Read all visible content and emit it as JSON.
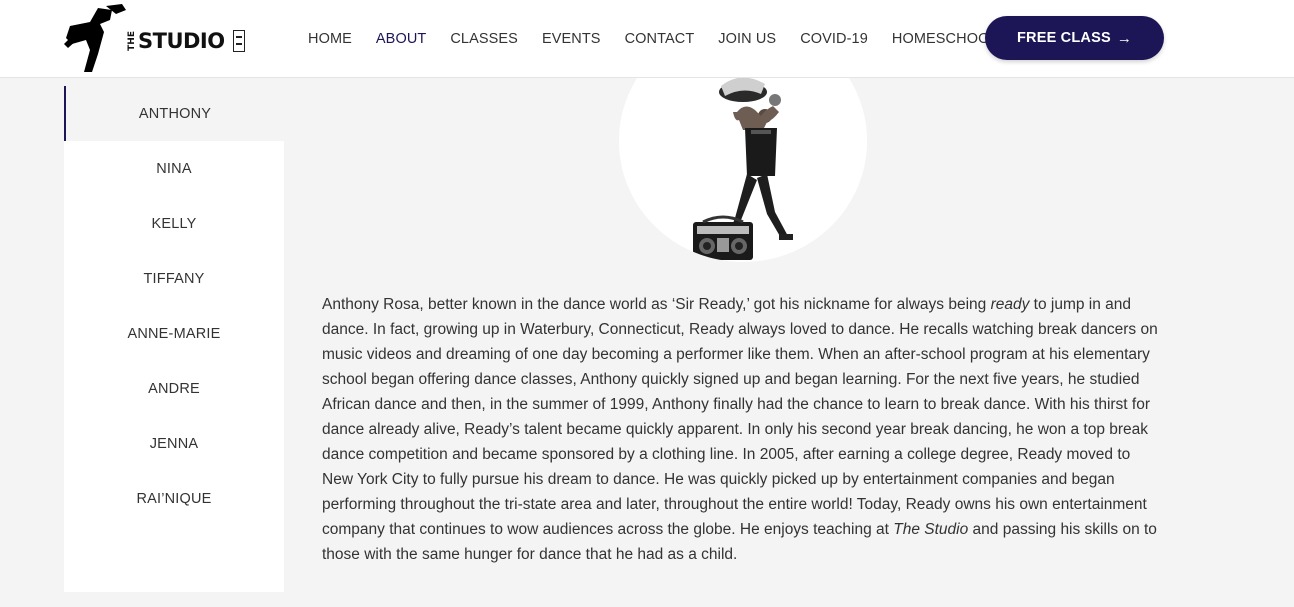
{
  "header": {
    "logo_text": "STUDIO",
    "logo_small": "THE"
  },
  "nav": {
    "items": [
      {
        "label": "HOME",
        "active": false
      },
      {
        "label": "ABOUT",
        "active": true
      },
      {
        "label": "CLASSES",
        "active": false
      },
      {
        "label": "EVENTS",
        "active": false
      },
      {
        "label": "CONTACT",
        "active": false
      },
      {
        "label": "JOIN US",
        "active": false
      },
      {
        "label": "COVID-19",
        "active": false
      },
      {
        "label": "HOMESCHOOL",
        "active": false
      }
    ],
    "cta_label": "FREE CLASS",
    "cta_icon": "arrow-right-icon"
  },
  "sidebar": {
    "items": [
      {
        "label": "ANTHONY",
        "active": true
      },
      {
        "label": "NINA",
        "active": false
      },
      {
        "label": "KELLY",
        "active": false
      },
      {
        "label": "TIFFANY",
        "active": false
      },
      {
        "label": "ANNE-MARIE",
        "active": false
      },
      {
        "label": "ANDRE",
        "active": false
      },
      {
        "label": "JENNA",
        "active": false
      },
      {
        "label": "RAI’NIQUE",
        "active": false
      }
    ]
  },
  "bio": {
    "p1_a": "Anthony Rosa, better known in the dance world as ‘Sir Ready,’ got his nickname for always being ",
    "p1_em": "ready",
    "p1_b": " to jump in and dance. In fact, growing up in Waterbury, Connecticut, Ready always loved to dance. He recalls watching break dancers on music videos and dreaming of one day becoming a performer like them. When an after-school program at his elementary school began offering dance classes, Anthony quickly signed up and began learning. For the next five years, he studied African dance and then, in the summer of 1999, Anthony finally had the chance to learn to break dance. With his thirst for dance already alive, Ready’s talent became quickly apparent. In only his second year break dancing, he won a top break dance competition and became sponsored by a clothing line. In 2005, after earning a college degree, Ready moved to New York City to fully pursue his dream to dance. He was quickly picked up by entertainment companies and began performing throughout the tri-state area and later, throughout the entire world! Today, Ready owns his own entertainment company that continues to wow audiences across the globe. He enjoys teaching at ",
    "p1_em2": "The Studio",
    "p1_c": " and passing his skills on to those with the same hunger for dance that he had as a child."
  },
  "colors": {
    "accent": "#1c1656",
    "background": "#f4f4f4",
    "text": "#333333"
  }
}
